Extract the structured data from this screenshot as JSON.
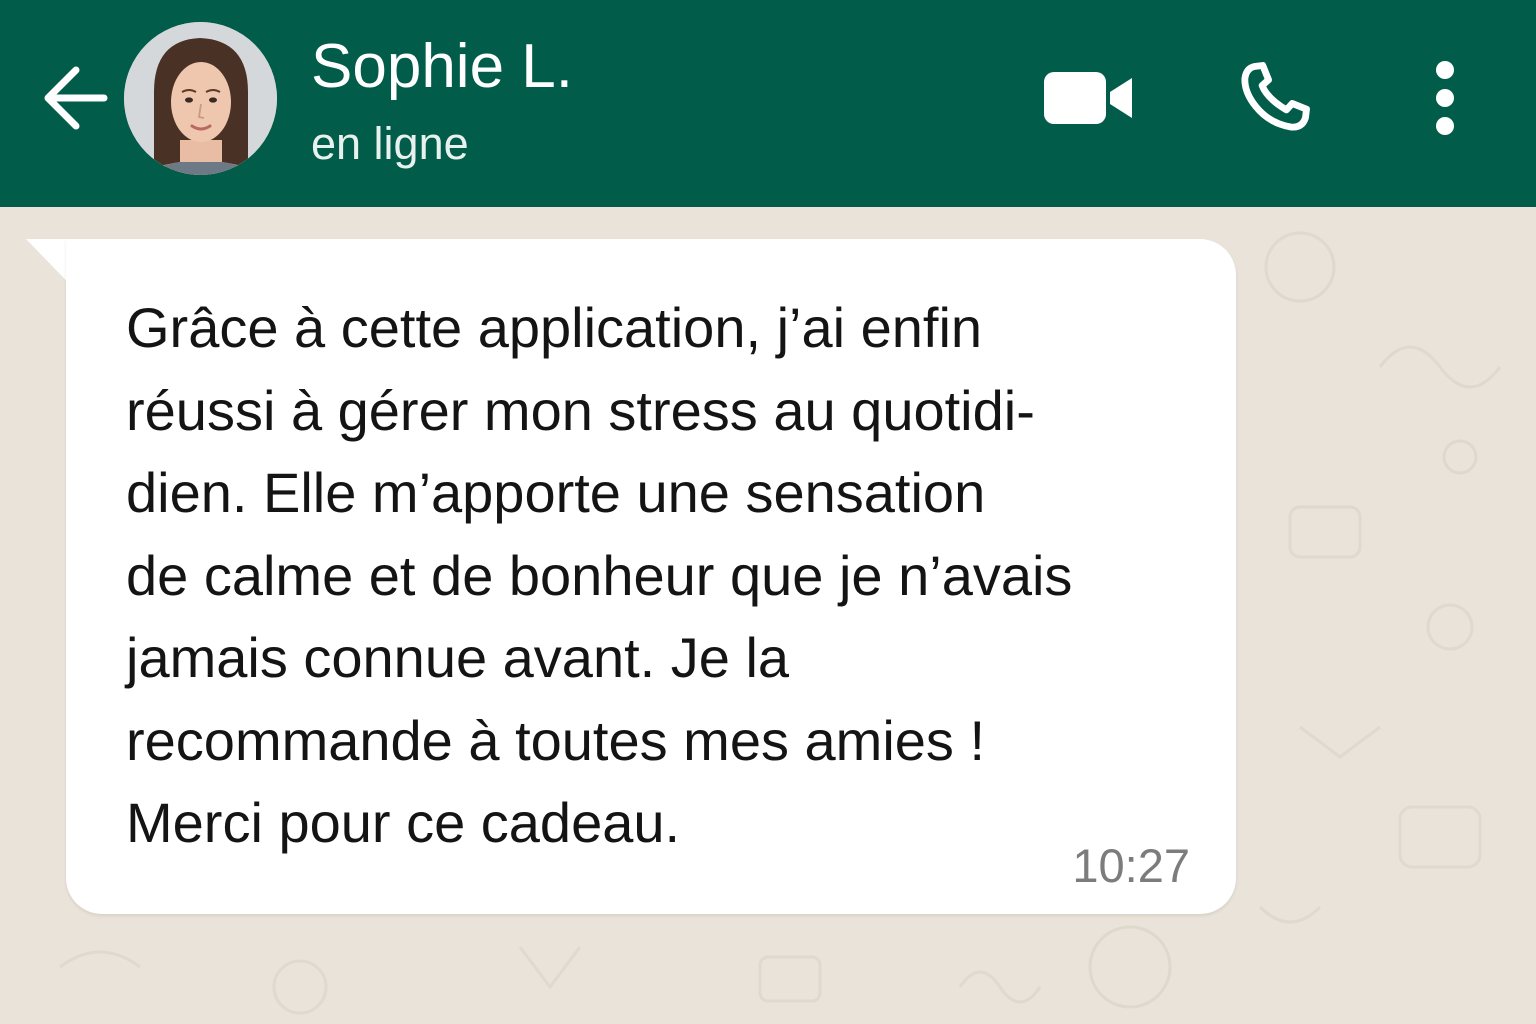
{
  "header": {
    "contact_name": "Sophie L.",
    "status": "en ligne",
    "back_icon": "arrow-left-icon",
    "video_icon": "video-camera-icon",
    "call_icon": "phone-icon",
    "menu_icon": "more-vertical-icon",
    "background_color": "#025c4a"
  },
  "chat": {
    "background_color": "#e9e3d9",
    "messages": [
      {
        "direction": "incoming",
        "lines": [
          "Grâce à cette application, j’ai enfin",
          "réussi à gérer mon stress au quotidi-",
          "dien. Elle m’apporte une sensation",
          "de calme et de bonheur que je n’avais",
          "jamais connue avant. Je la",
          "recommande à toutes mes amies !",
          "Merci pour ce cadeau."
        ],
        "time": "10:27",
        "bubble_color": "#ffffff"
      }
    ]
  }
}
